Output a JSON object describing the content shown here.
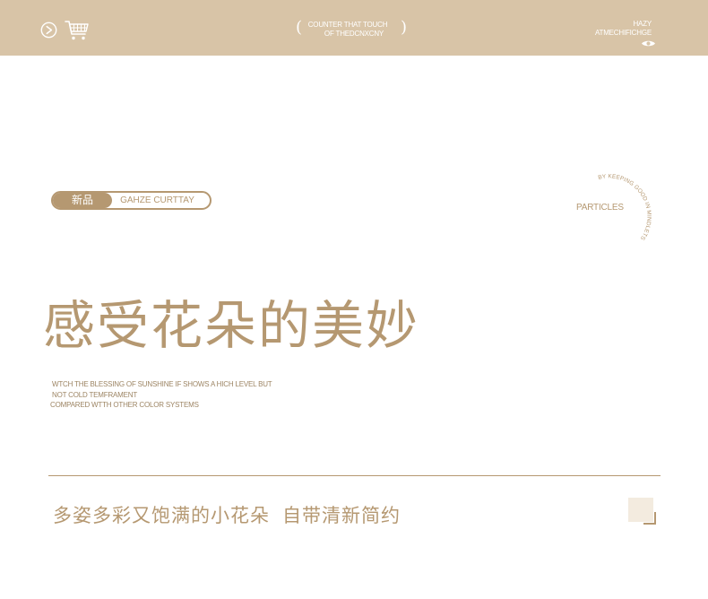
{
  "header": {
    "center_text_line1": "COUNTER THAT TOUCH",
    "center_text_line2": "OF THEDCNXCNY",
    "bracket_left": "(",
    "bracket_right": ")",
    "right_text_line1": "HAZY",
    "right_text_line2": "ATMECHIFICHGE"
  },
  "badge": {
    "tag": "新品",
    "name": "GAHZE CURTTAY"
  },
  "side": {
    "label": "PARTICLES",
    "ring_text": "BY KEEPING GOOD IN MINDLETS GO NOW"
  },
  "headline": "感受花朵的美妙",
  "description": {
    "line1": "WTCH THE BLESSING OF SUNSHINE IF SHOWS A HICH LEVEL BUT",
    "line2": "NOT COLD TEMFRAMENT",
    "line3": "COMPARED WTTH OTHER COLOR SYSTEMS"
  },
  "subline": {
    "part1": "多姿多彩又饱满的小花朵",
    "part2": "自带清新简约"
  },
  "icons": {
    "play": "play-circle-icon",
    "cart": "shopping-cart-icon",
    "eye": "eye-icon"
  },
  "colors": {
    "header_bg": "#d8c4a7",
    "accent": "#b59871",
    "text_light": "#ffffff"
  }
}
